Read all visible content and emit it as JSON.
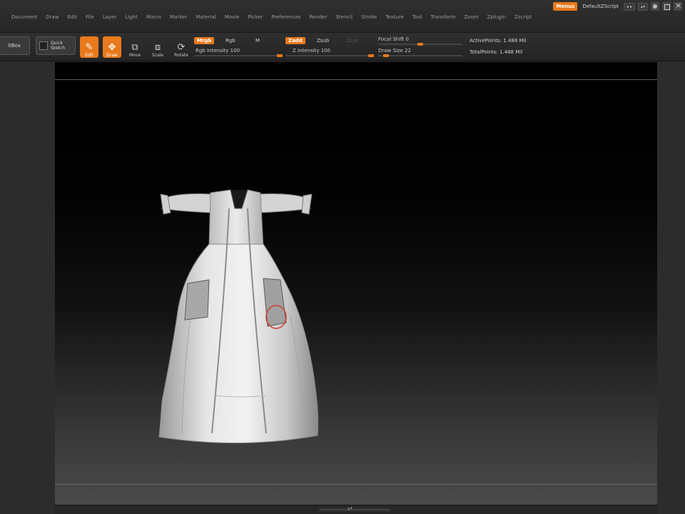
{
  "menubar": {
    "items": [
      "Document",
      "Draw",
      "Edit",
      "File",
      "Layer",
      "Light",
      "Macro",
      "Marker",
      "Material",
      "Movie",
      "Picker",
      "Preferences",
      "Render",
      "Stencil",
      "Stroke",
      "Texture",
      "Tool",
      "Transform",
      "Zoom",
      "Zplugin",
      "Zscript"
    ],
    "menus_label": "Menus",
    "script_label": "DefaultZScript",
    "small_btn_1": "◂ ▸",
    "small_btn_2": "▴▾"
  },
  "toolbar": {
    "lightbox_label": "ltBox",
    "quick_sketch_label": "Quick Sketch",
    "edit_label": "Edit",
    "draw_label": "Draw",
    "move_label": "Move",
    "scale_label": "Scale",
    "rotate_label": "Rotate",
    "mrgb_label": "Mrgb",
    "rgb_label": "Rgb",
    "m_label": "M",
    "rgb_intensity_label": "Rgb Intensity 100",
    "zadd_label": "Zadd",
    "zsub_label": "Zsub",
    "zcut_label": "Zcut",
    "z_intensity_label": "Z Intensity 100",
    "focal_shift_label": "Focal Shift 0",
    "draw_size_label": "Draw Size 22",
    "active_points_label": "ActivePoints: 1.488 Mil",
    "total_points_label": "TotalPoints: 1.488 Mil"
  },
  "sliders": {
    "rgb_intensity": 1.0,
    "z_intensity": 1.0,
    "focal_shift": 0.5,
    "draw_size": 0.09
  },
  "colors": {
    "accent": "#e8791c",
    "model": "#d9d9d9"
  },
  "icons": {
    "edit": "pencil-icon",
    "draw": "draw-icon",
    "move": "move-icon",
    "scale": "scale-icon",
    "rotate": "rotate-icon"
  }
}
